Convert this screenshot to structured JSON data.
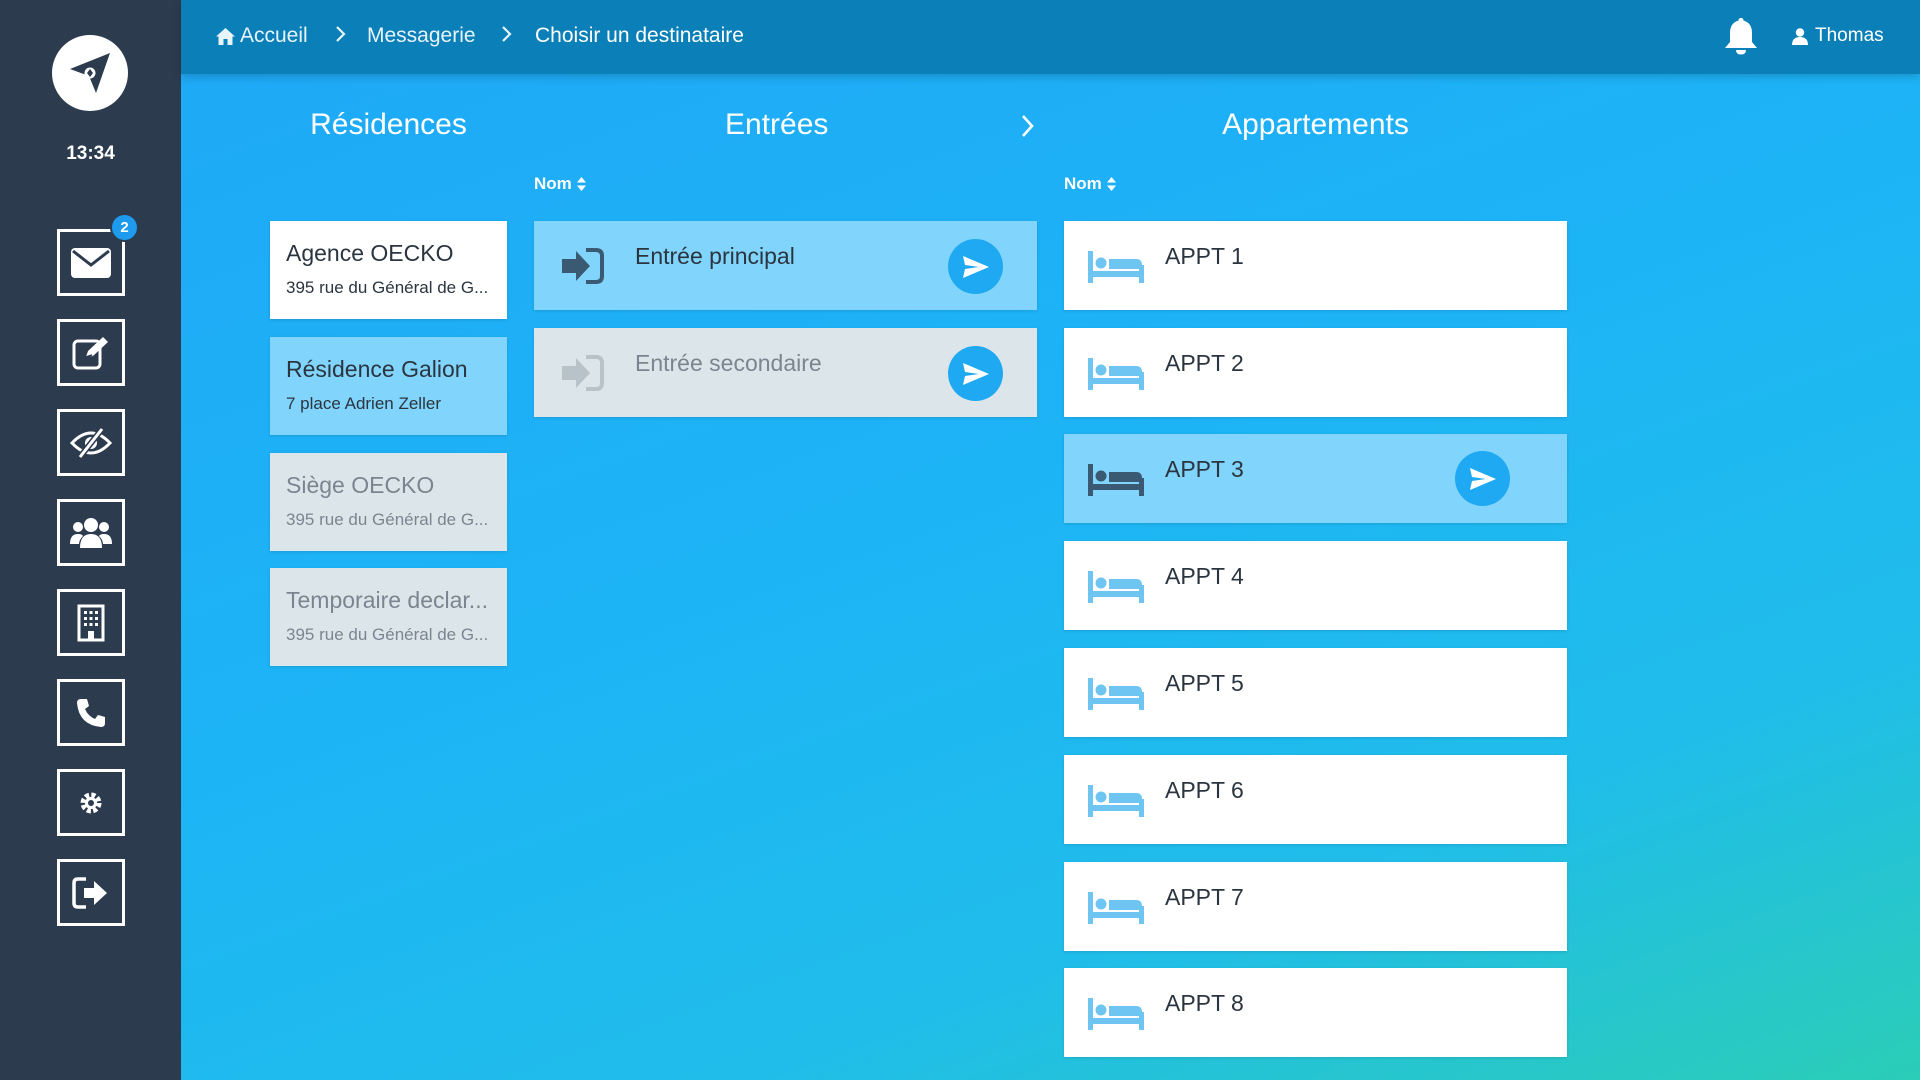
{
  "sidebar": {
    "clock": "13:34",
    "mail_badge": "2",
    "buttons": [
      "envelope-icon",
      "edit-icon",
      "eye-slash-icon",
      "users-icon",
      "building-icon",
      "phone-icon",
      "settings-icon",
      "logout-icon"
    ]
  },
  "header": {
    "breadcrumb": [
      "Accueil",
      "Messagerie",
      "Choisir un destinataire"
    ],
    "user_name": "Thomas"
  },
  "columns": {
    "residences_title": "Résidences",
    "entrees_title": "Entrées",
    "appartements_title": "Appartements",
    "sort_label": "Nom"
  },
  "residences": [
    {
      "name": "Agence OECKO",
      "address": "395 rue du Général de G...",
      "state": "available"
    },
    {
      "name": "Résidence Galion",
      "address": "7 place Adrien Zeller",
      "state": "selected"
    },
    {
      "name": "Siège OECKO",
      "address": "395 rue du Général de G...",
      "state": "disabled"
    },
    {
      "name": "Temporaire declar...",
      "address": "395 rue du Général de G...",
      "state": "disabled"
    }
  ],
  "entrees": [
    {
      "label": "Entrée principal",
      "state": "selected"
    },
    {
      "label": "Entrée secondaire",
      "state": "disabled"
    }
  ],
  "appartements": [
    {
      "label": "APPT 1",
      "state": "available"
    },
    {
      "label": "APPT 2",
      "state": "available"
    },
    {
      "label": "APPT 3",
      "state": "selected"
    },
    {
      "label": "APPT 4",
      "state": "available"
    },
    {
      "label": "APPT 5",
      "state": "available"
    },
    {
      "label": "APPT 6",
      "state": "available"
    },
    {
      "label": "APPT 7",
      "state": "available"
    },
    {
      "label": "APPT 8",
      "state": "available"
    }
  ],
  "colors": {
    "sidebar": "#2d3b4e",
    "topbar": "#0a7fb8",
    "selected_card": "#81d4fb",
    "disabled_card": "#dce6ea",
    "send_button": "#1fa9f2",
    "badge": "#1e9bef"
  }
}
